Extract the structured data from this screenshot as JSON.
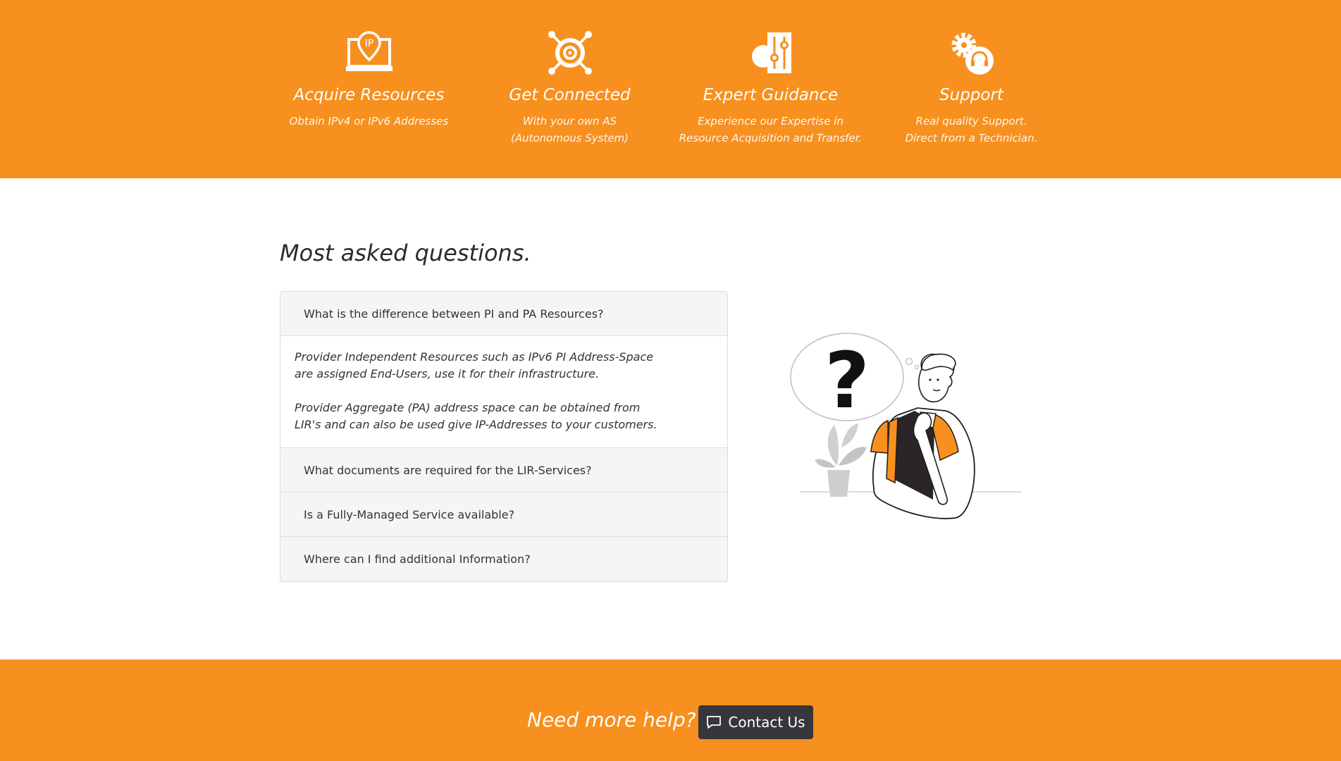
{
  "features": [
    {
      "icon": "ip-laptop-icon",
      "title": "Acquire Resources",
      "subtitle_line1": "Obtain IPv4 or IPv6 Addresses",
      "subtitle_line2": ""
    },
    {
      "icon": "network-target-icon",
      "title": "Get Connected",
      "subtitle_line1": "With your own AS",
      "subtitle_line2": "(Autonomous System)"
    },
    {
      "icon": "gear-sliders-icon",
      "title": "Expert Guidance",
      "subtitle_line1": "Experience our Expertise in",
      "subtitle_line2": "Resource Acquisition and Transfer."
    },
    {
      "icon": "gear-headset-icon",
      "title": "Support",
      "subtitle_line1": "Real quality Support.",
      "subtitle_line2": "Direct from a Technician."
    }
  ],
  "faq": {
    "title": "Most asked questions.",
    "items": [
      {
        "question": "What is the difference between PI and PA Resources?",
        "expanded": true,
        "answer_p1": "Provider Independent Resources such as IPv6 PI Address-Space are assigned End-Users, use it for their infrastructure.",
        "answer_p2": "Provider Aggregate (PA) address space can be obtained from LIR's and can also be used give IP-Addresses to your customers."
      },
      {
        "question": "What documents are required for the LIR-Services?",
        "expanded": false
      },
      {
        "question": "Is a Fully-Managed Service available?",
        "expanded": false
      },
      {
        "question": "Where can I find additional Information?",
        "expanded": false
      }
    ]
  },
  "footer": {
    "help_text": "Need more help?",
    "contact_label": "Contact Us",
    "contact_icon": "chat-bubble-icon"
  },
  "colors": {
    "accent": "#f7901e",
    "button": "#35373a",
    "panel": "#f5f5f5"
  }
}
